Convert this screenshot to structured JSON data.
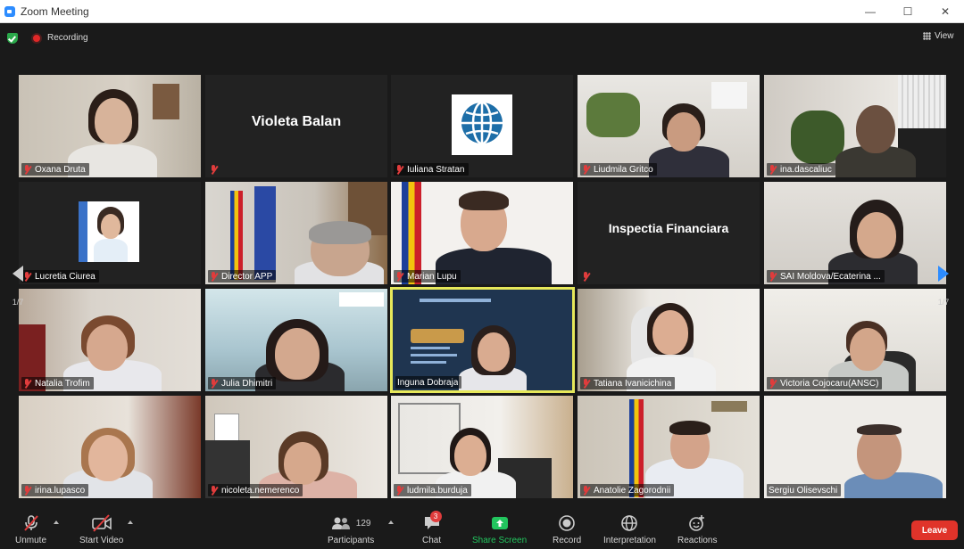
{
  "window": {
    "title": "Zoom Meeting"
  },
  "top": {
    "recording_label": "Recording",
    "view_label": "View"
  },
  "nav": {
    "page_left": "1/7",
    "page_right": "1/7"
  },
  "participants": [
    {
      "name": "Oxana Druta",
      "display": ""
    },
    {
      "name": "",
      "display": "Violeta Balan"
    },
    {
      "name": "Iuliana Stratan",
      "display": ""
    },
    {
      "name": "Liudmila Gritco",
      "display": ""
    },
    {
      "name": "ina.dascaliuc",
      "display": ""
    },
    {
      "name": "Lucretia Ciurea",
      "display": ""
    },
    {
      "name": "Director APP",
      "display": ""
    },
    {
      "name": "Marian Lupu",
      "display": ""
    },
    {
      "name": "",
      "display": "Inspectia Financiara"
    },
    {
      "name": "SAI Moldova/Ecaterina ...",
      "display": ""
    },
    {
      "name": "Natalia Trofim",
      "display": ""
    },
    {
      "name": "Julia Dhimitri",
      "display": ""
    },
    {
      "name": "Inguna Dobraja",
      "display": ""
    },
    {
      "name": "Tatiana Ivanicichina",
      "display": ""
    },
    {
      "name": "Victoria Cojocaru(ANSC)",
      "display": ""
    },
    {
      "name": "irina.lupasco",
      "display": ""
    },
    {
      "name": "nicoleta.nemerenco",
      "display": ""
    },
    {
      "name": "ludmila.burduja",
      "display": ""
    },
    {
      "name": "Anatolie Zagorodnii",
      "display": ""
    },
    {
      "name": "Sergiu Olisevschi",
      "display": ""
    }
  ],
  "toolbar": {
    "unmute": "Unmute",
    "start_video": "Start Video",
    "participants": "Participants",
    "participants_count": "129",
    "chat": "Chat",
    "chat_badge": "3",
    "share_screen": "Share Screen",
    "record": "Record",
    "interpretation": "Interpretation",
    "reactions": "Reactions",
    "leave": "Leave"
  },
  "colors": {
    "share_green": "#22c55e",
    "leave_red": "#e0332a",
    "active_speaker": "#e6e85a",
    "accent_blue": "#2d8cff"
  }
}
